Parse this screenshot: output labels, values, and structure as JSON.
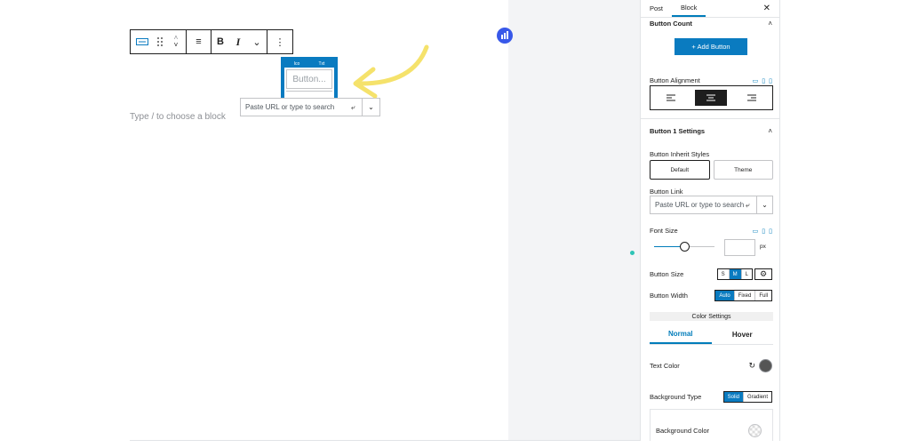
{
  "editor": {
    "placeholder": "Type / to choose a block",
    "button_placeholder": "Button...",
    "mini_tabs": [
      "Ico",
      "Txt"
    ],
    "link_popover": {
      "placeholder": "Paste URL or type to search",
      "enter_glyph": "⤶",
      "dropdown_glyph": "⌄"
    },
    "toolbar": {
      "bold_label": "B",
      "italic_label": "I",
      "more_glyph": "⋮",
      "chevron_glyph": "⌄",
      "align_glyph": "≡"
    }
  },
  "colors": {
    "accent": "#0a7bc0",
    "arrow": "#f5e26b",
    "teal_dot": "#2ec4b6",
    "text_color_swatch": "#555555"
  },
  "sidebar": {
    "tabs": [
      "Post",
      "Block"
    ],
    "active_tab": "Block",
    "close_glyph": "✕",
    "button_count": {
      "title": "Button Count",
      "add_label": "+ Add Button"
    },
    "button_alignment": {
      "label": "Button Alignment",
      "options": [
        "left",
        "center",
        "right"
      ],
      "selected": "center"
    },
    "button_1_settings": {
      "title": "Button 1 Settings"
    },
    "inherit": {
      "label": "Button Inherit Styles",
      "options": [
        "Default",
        "Theme"
      ],
      "selected": "Default"
    },
    "button_link": {
      "label": "Button Link",
      "placeholder": "Paste URL or type to search",
      "enter_glyph": "⤶",
      "dropdown_glyph": "⌄"
    },
    "font_size": {
      "label": "Font Size",
      "unit": "px",
      "value": ""
    },
    "button_size": {
      "label": "Button Size",
      "options": [
        "S",
        "M",
        "L"
      ],
      "selected": "M",
      "gear_glyph": "⚙"
    },
    "button_width": {
      "label": "Button Width",
      "options": [
        "Auto",
        "Fixed",
        "Full"
      ],
      "selected": "Auto"
    },
    "color_settings": {
      "title": "Color Settings",
      "tabs": [
        "Normal",
        "Hover"
      ],
      "active": "Normal"
    },
    "text_color": {
      "label": "Text Color",
      "reset_glyph": "↻"
    },
    "background_type": {
      "label": "Background Type",
      "options": [
        "Solid",
        "Gradient"
      ],
      "selected": "Solid"
    },
    "background_color": {
      "label": "Background Color"
    }
  }
}
